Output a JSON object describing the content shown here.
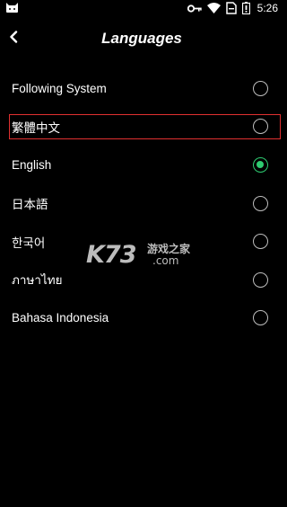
{
  "status_bar": {
    "time": "5:26",
    "icons": [
      "app-cat-icon",
      "key-icon",
      "wifi-icon",
      "no-sim-icon",
      "battery-icon"
    ]
  },
  "header": {
    "back_icon": "chevron-left-icon",
    "title": "Languages"
  },
  "languages": [
    {
      "label": "Following System",
      "selected": false,
      "highlighted": false
    },
    {
      "label": "繁體中文",
      "selected": false,
      "highlighted": true
    },
    {
      "label": "English",
      "selected": true,
      "highlighted": false
    },
    {
      "label": "日本語",
      "selected": false,
      "highlighted": false
    },
    {
      "label": "한국어",
      "selected": false,
      "highlighted": false
    },
    {
      "label": "ภาษาไทย",
      "selected": false,
      "highlighted": false
    },
    {
      "label": "Bahasa Indonesia",
      "selected": false,
      "highlighted": false
    }
  ],
  "watermark": {
    "brand": "K73",
    "cn_text": "游戏之家",
    "domain": ".com"
  },
  "colors": {
    "background": "#000000",
    "text": "#ffffff",
    "radio_checked": "#2ecc71",
    "radio_unchecked": "#bdbdbd",
    "highlight_border": "#e03030"
  }
}
